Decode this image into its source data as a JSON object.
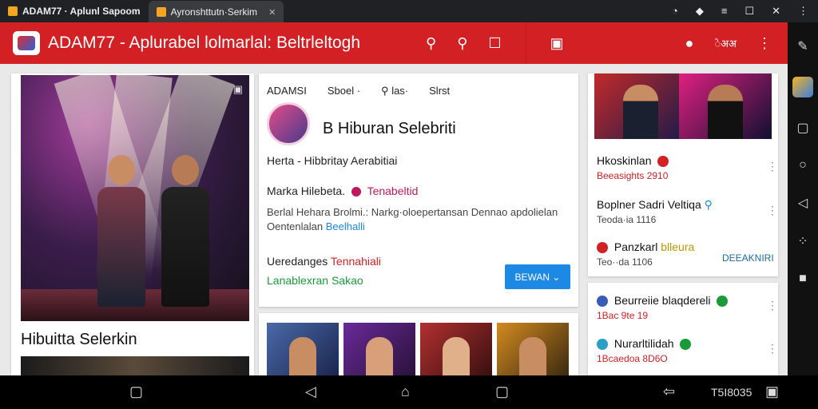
{
  "tabs": [
    {
      "label": "ADAM77 · Aplunl Sapoom"
    },
    {
      "label": "Ayronshttutn·Serkim"
    }
  ],
  "app": {
    "title": "ADAM77 - Aplurabel lolmarlal: Beltrleltogh",
    "right_text": "ेअअ"
  },
  "center": {
    "tabs": [
      "ADAMSI",
      "Sboel ·",
      "las·",
      "Slrst"
    ],
    "profile_name": "B Hiburan Selebriti",
    "subtitle": "Herta - Hibbritay Aerabitiai",
    "line1_a": "Marka Hilebeta.",
    "line1_b": "Tenabeltid",
    "desc1": "Berlal Hehara Brolmi.: Narkg·oloepertansan Dennao apdolielan",
    "desc2_a": "Oentenlalan",
    "desc2_b": "Beelhalli",
    "upd_label": "Ueredanges",
    "upd_value": "Tennahiali",
    "green_text": "Lanablexran Sakao",
    "cta": "BEWAN ⌄"
  },
  "hero_caption": "Hibuitta Selerkin",
  "right": {
    "items": [
      {
        "title": "Hkoskinlan",
        "sub": "Beeasights 2910",
        "sub_color": "#d32025"
      },
      {
        "title": "Boplner Sadri Veltiqa",
        "sub": "Teoda·ia 1116",
        "sub_color": "#444444"
      },
      {
        "title": "Panzkarl",
        "title_b": "blleura",
        "sub": "Teo··da 1106",
        "sub_color": "#444444",
        "extra": "DEEAKNIRI"
      },
      {
        "title": "Beurreiie blaqdereli",
        "sub": "1Bac 9te 19",
        "sub_color": "#d32025"
      },
      {
        "title": "Nurarltilidah",
        "sub": "1Bcaedoa 8D6O",
        "sub_color": "#d32025"
      }
    ]
  },
  "clock": "T5I8035",
  "colors": {
    "accent": "#d32025",
    "cta": "#1e88e5",
    "green": "#1a9b3a"
  }
}
